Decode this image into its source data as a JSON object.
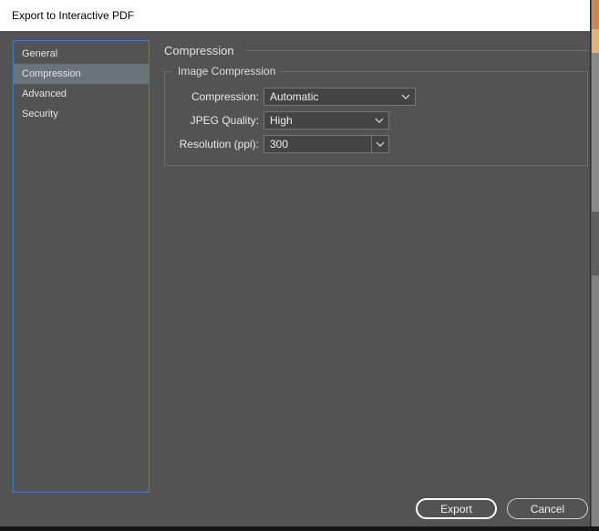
{
  "window": {
    "title": "Export to Interactive PDF"
  },
  "sidebar": {
    "items": [
      {
        "label": "General",
        "selected": false
      },
      {
        "label": "Compression",
        "selected": true
      },
      {
        "label": "Advanced",
        "selected": false
      },
      {
        "label": "Security",
        "selected": false
      }
    ]
  },
  "panel": {
    "title": "Compression",
    "group": {
      "title": "Image Compression",
      "fields": [
        {
          "label": "Compression:",
          "value": "Automatic",
          "type": "dropdown"
        },
        {
          "label": "JPEG Quality:",
          "value": "High",
          "type": "dropdown"
        },
        {
          "label": "Resolution (ppi):",
          "value": "300",
          "type": "combo"
        }
      ]
    }
  },
  "footer": {
    "export_label": "Export",
    "cancel_label": "Cancel"
  },
  "colors": {
    "dialog_bg": "#535353",
    "titlebar_bg": "#ffffff",
    "sidebar_focus_border": "#3d7fc1",
    "selection_bg": "#6a727c",
    "field_bg": "#444444",
    "field_border": "#757575",
    "text": "#e4e4e4",
    "default_button_border": "#fafafa"
  }
}
